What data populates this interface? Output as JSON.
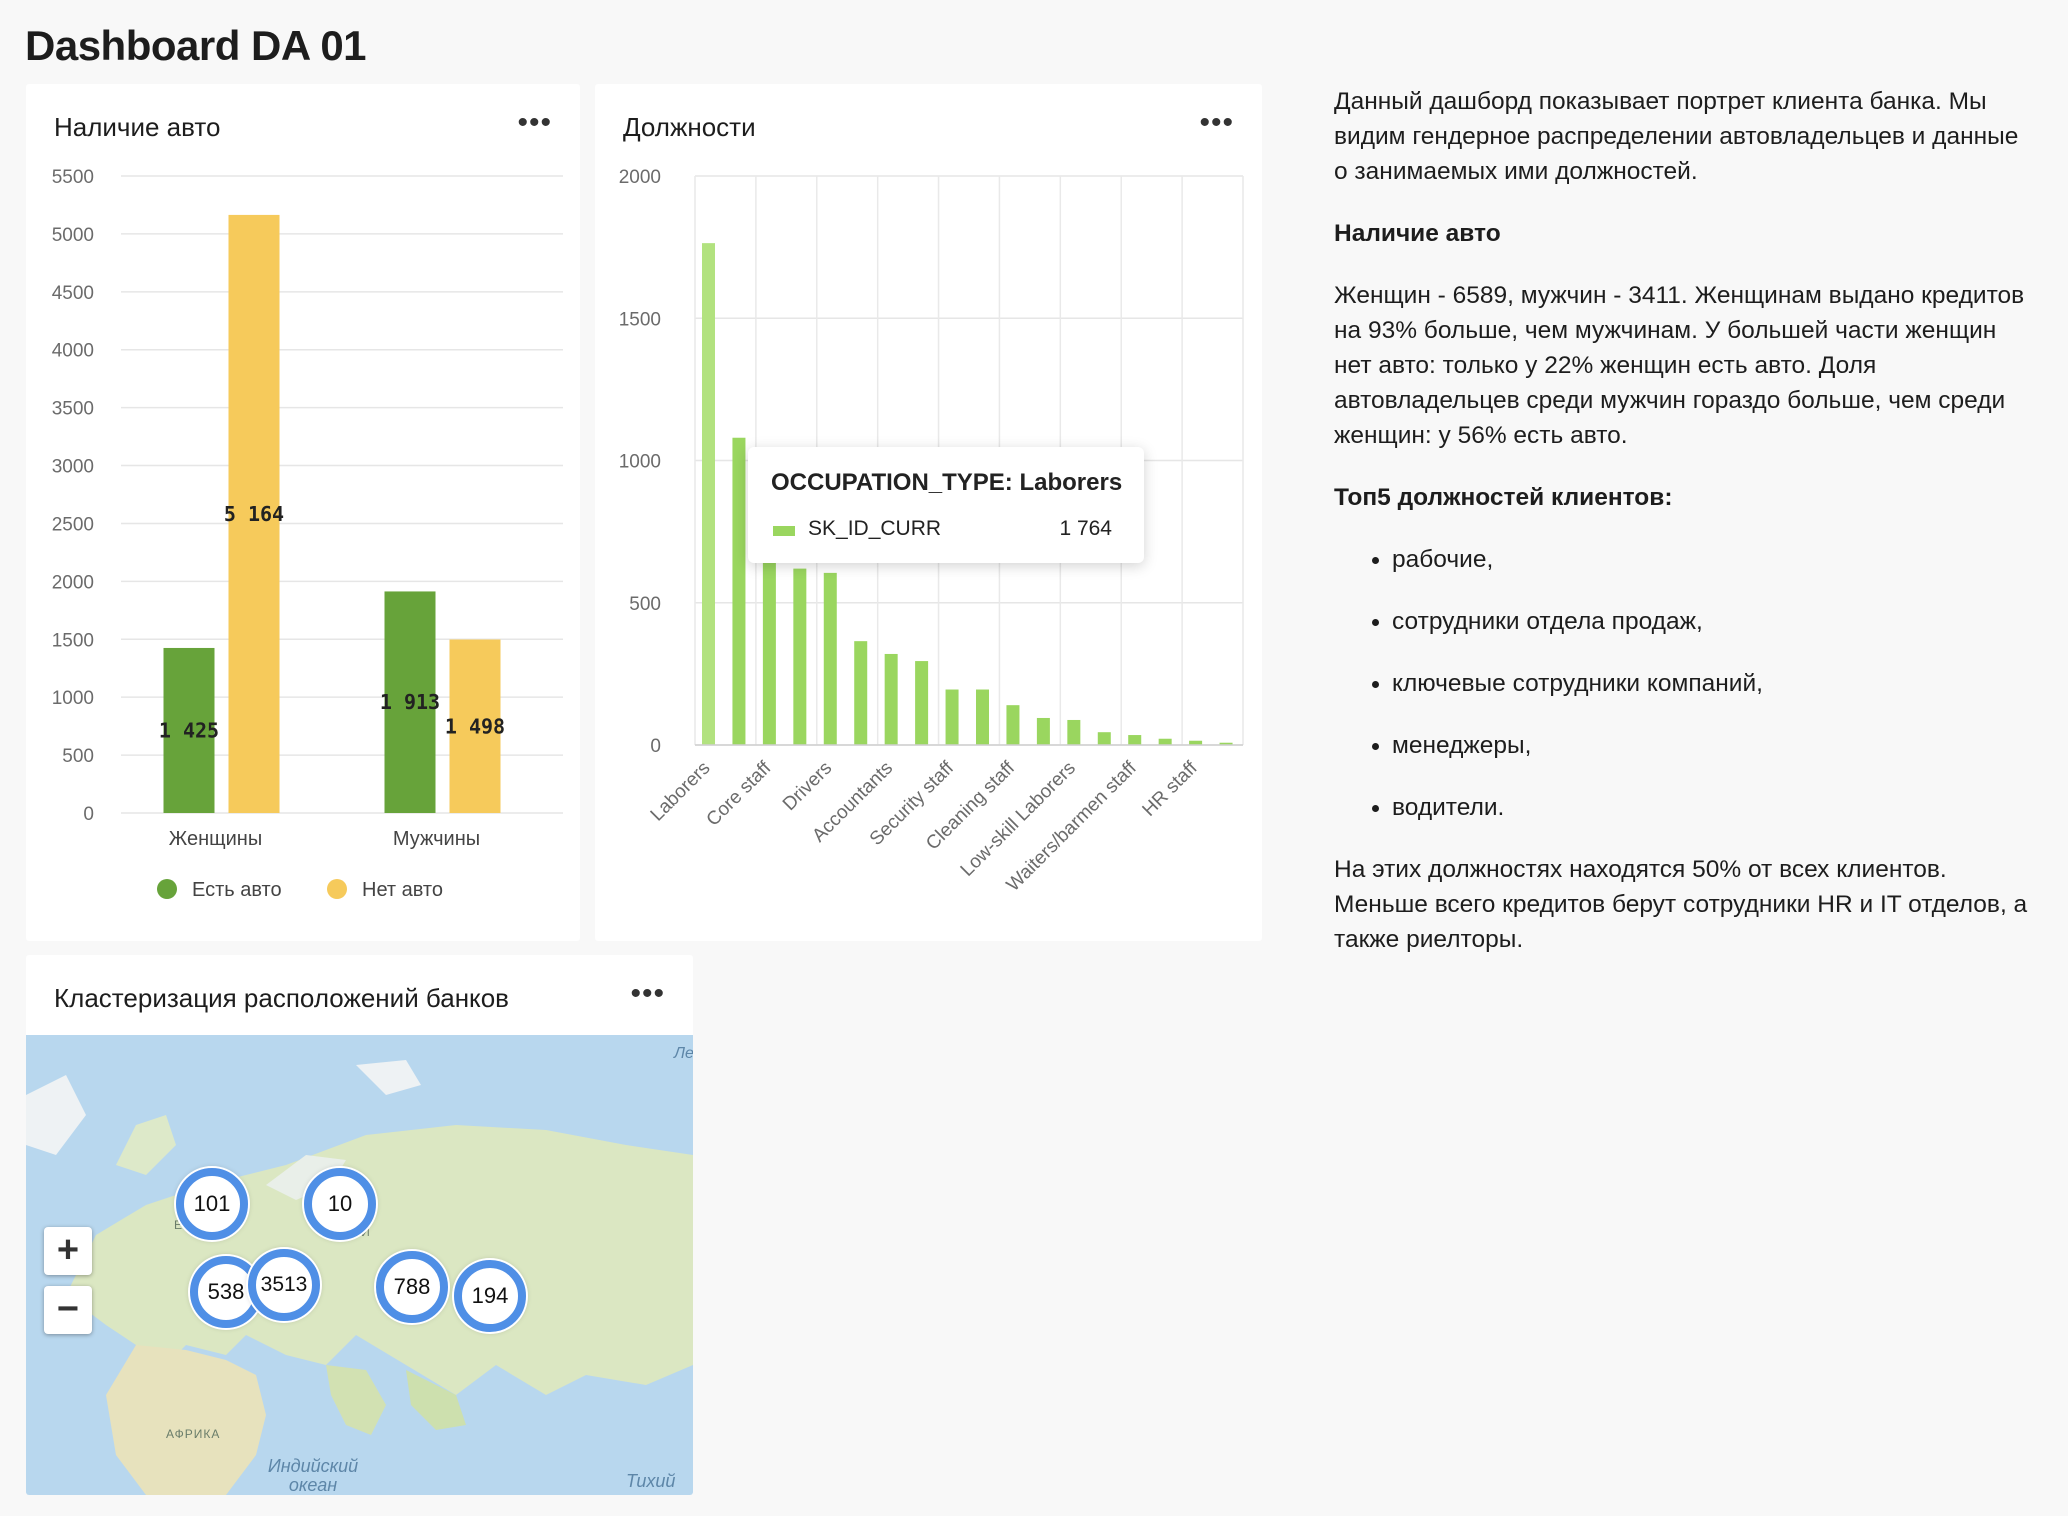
{
  "page": {
    "title": "Dashboard DA 01"
  },
  "widgets": {
    "cars": {
      "title": "Наличие авто",
      "menu": "•••"
    },
    "jobs": {
      "title": "Должности",
      "menu": "•••"
    },
    "map": {
      "title": "Кластеризация расположений банков",
      "menu": "•••"
    }
  },
  "chart_data": [
    {
      "type": "bar",
      "categories": [
        "Женщины",
        "Мужчины"
      ],
      "series": [
        {
          "name": "Есть авто",
          "values": [
            1425,
            1913
          ],
          "labels": [
            "1 425",
            "1 913"
          ]
        },
        {
          "name": "Нет авто",
          "values": [
            5164,
            1498
          ],
          "labels": [
            "5 164",
            "1 498"
          ]
        }
      ],
      "ylim": [
        0,
        5500
      ],
      "yticks": [
        0,
        500,
        1000,
        1500,
        2000,
        2500,
        3000,
        3500,
        4000,
        4500,
        5000,
        5500
      ],
      "colors": [
        "#67a33a",
        "#f6ca5b"
      ],
      "legend": "bottom",
      "grid": true
    },
    {
      "type": "bar",
      "categories": [
        "Laborers",
        "Core staff",
        "Drivers",
        "Accountants",
        "Security staff",
        "Cleaning staff",
        "Low-skill Laborers",
        "Waiters/barmen staff",
        "HR staff"
      ],
      "bars": [
        1764,
        1080,
        720,
        620,
        605,
        365,
        320,
        295,
        195,
        195,
        140,
        95,
        88,
        45,
        35,
        22,
        15,
        8
      ],
      "series": [
        {
          "name": "SK_ID_CURR"
        }
      ],
      "ylim": [
        0,
        2000
      ],
      "yticks": [
        0,
        500,
        1000,
        1500,
        2000
      ],
      "color": "#9ad65f",
      "highlight_color": "#b2e27f",
      "grid": true,
      "tooltip": {
        "title": "OCCUPATION_TYPE: Laborers",
        "series": "SK_ID_CURR",
        "value": "1 764"
      }
    }
  ],
  "description": {
    "intro": "Данный дашборд показывает портрет клиента банка. Мы видим гендерное распределении автовладельцев и данные о занимаемых ими должностей.",
    "heading1": "Наличие авто",
    "para1": "Женщин - 6589, мужчин - 3411. Женщинам выдано кредитов  на 93% больше, чем мужчинам. У большей части женщин нет авто: только у 22% женщин есть авто. Доля автовладельцев среди мужчин гораздо больше, чем среди женщин: у 56% есть авто.",
    "heading2": "Топ5 должностей клиентов:",
    "items": [
      "рабочие,",
      "сотрудники отдела продаж,",
      "ключевые сотрудники компаний,",
      "менеджеры,",
      "водители."
    ],
    "para2": "На этих должностях находятся 50% от всех клиентов. Меньше всего кредитов берут сотрудники HR и IT отделов, а также риелторы."
  },
  "map": {
    "zoom_in": "+",
    "zoom_out": "−",
    "clusters": [
      "101",
      "10",
      "538",
      "3513",
      "788",
      "194"
    ],
    "labels": {
      "ocean_indian": "Индийский океан",
      "ocean_pacific": "Тихий",
      "africa": "АФРИКА",
      "asia": "АЗИ",
      "europe": "ЕВ",
      "top_right": "Ле"
    },
    "colors": {
      "water": "#b8d7ee",
      "land": "#dbe7c2",
      "cluster_ring": "#4f8fe6"
    }
  }
}
